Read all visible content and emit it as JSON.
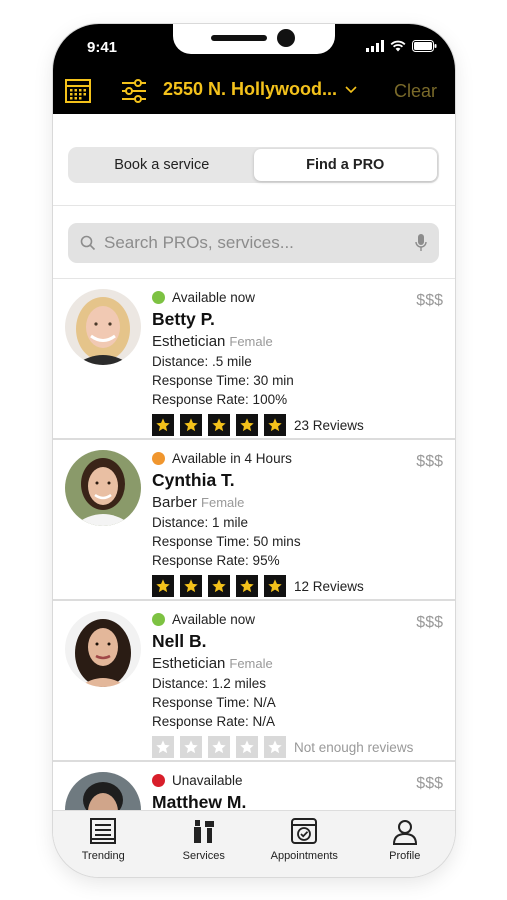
{
  "status_bar": {
    "time": "9:41"
  },
  "header": {
    "address": "2550 N. Hollywood...",
    "clear_label": "Clear"
  },
  "segment": {
    "options": [
      "Book a service",
      "Find a PRO"
    ],
    "selected": "Find a PRO"
  },
  "search": {
    "placeholder": "Search PROs, services..."
  },
  "pros": [
    {
      "availability": "Available now",
      "status_color": "#7dc242",
      "name": "Betty P.",
      "role": "Esthetician",
      "gender": "Female",
      "distance": "Distance: .5 mile",
      "response_time": "Response Time: 30 min",
      "response_rate": "Response Rate: 100%",
      "rating": 5,
      "reviews": "23 Reviews",
      "price": "$$$"
    },
    {
      "availability": "Available in 4 Hours",
      "status_color": "#f0962e",
      "name": "Cynthia T.",
      "role": "Barber",
      "gender": "Female",
      "distance": "Distance: 1 mile",
      "response_time": "Response Time: 50 mins",
      "response_rate": "Response Rate: 95%",
      "rating": 5,
      "reviews": "12 Reviews",
      "price": "$$$"
    },
    {
      "availability": "Available now",
      "status_color": "#7dc242",
      "name": "Nell B.",
      "role": "Esthetician",
      "gender": "Female",
      "distance": "Distance: 1.2 miles",
      "response_time": "Response Time: N/A",
      "response_rate": "Response Rate: N/A",
      "rating": 0,
      "reviews": "Not enough reviews",
      "price": "$$$"
    },
    {
      "availability": "Unavailable",
      "status_color": "#d81e2a",
      "name": "Matthew M.",
      "price": "$$$"
    }
  ],
  "tabbar": {
    "items": [
      {
        "label": "Trending",
        "icon": "trending-icon"
      },
      {
        "label": "Services",
        "icon": "services-icon"
      },
      {
        "label": "Appointments",
        "icon": "appointments-icon"
      },
      {
        "label": "Profile",
        "icon": "profile-icon"
      }
    ]
  },
  "colors": {
    "accent": "#f4c21b",
    "header_bg": "#000000",
    "star": "#f4c21b"
  }
}
